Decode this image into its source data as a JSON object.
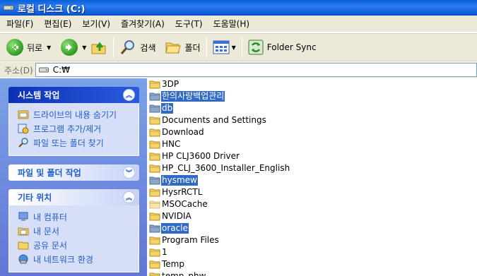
{
  "window": {
    "title": "로컬 디스크 (C:)"
  },
  "menu": [
    "파일(F)",
    "편집(E)",
    "보기(V)",
    "즐겨찾기(A)",
    "도구(T)",
    "도움말(H)"
  ],
  "toolbar": {
    "back_label": "뒤로",
    "search_label": "검색",
    "folders_label": "폴더",
    "folder_sync_label": "Folder Sync"
  },
  "address": {
    "label": "주소(D)",
    "value": "C:₩"
  },
  "left_pane": {
    "system_tasks": {
      "title": "시스템 작업",
      "items": [
        "드라이브의 내용 숨기기",
        "프로그램 추가/제거",
        "파일 또는 폴더 찾기"
      ]
    },
    "file_tasks": {
      "title": "파일 및 폴더 작업"
    },
    "other_places": {
      "title": "기타 위치",
      "items": [
        "내 컴퓨터",
        "내 문서",
        "공유 문서",
        "내 네트워크 환경"
      ]
    }
  },
  "files": [
    {
      "name": "3DP",
      "selected": false,
      "type": "folder"
    },
    {
      "name": "한의사랑백업관리",
      "selected": true,
      "type": "folder"
    },
    {
      "name": "db",
      "selected": true,
      "type": "folder"
    },
    {
      "name": "Documents and Settings",
      "selected": false,
      "type": "folder"
    },
    {
      "name": "Download",
      "selected": false,
      "type": "folder"
    },
    {
      "name": "HNC",
      "selected": false,
      "type": "folder"
    },
    {
      "name": "HP CLJ3600 Driver",
      "selected": false,
      "type": "folder"
    },
    {
      "name": "HP_CLJ_3600_Installer_English",
      "selected": false,
      "type": "folder"
    },
    {
      "name": "hysmew",
      "selected": true,
      "type": "folder"
    },
    {
      "name": "HysrRCTL",
      "selected": false,
      "type": "folder"
    },
    {
      "name": "MSOCache",
      "selected": false,
      "type": "folder-hidden"
    },
    {
      "name": "NVIDIA",
      "selected": false,
      "type": "folder"
    },
    {
      "name": "oracle",
      "selected": true,
      "type": "folder"
    },
    {
      "name": "Program Files",
      "selected": false,
      "type": "folder"
    },
    {
      "name": "1",
      "selected": false,
      "type": "folder"
    },
    {
      "name": "Temp",
      "selected": false,
      "type": "folder"
    },
    {
      "name": "temp_phw",
      "selected": false,
      "type": "folder"
    }
  ],
  "colors": {
    "selection": "#316ac5",
    "titlebar": "#0a5fd8",
    "folder": "#f5d36b"
  }
}
